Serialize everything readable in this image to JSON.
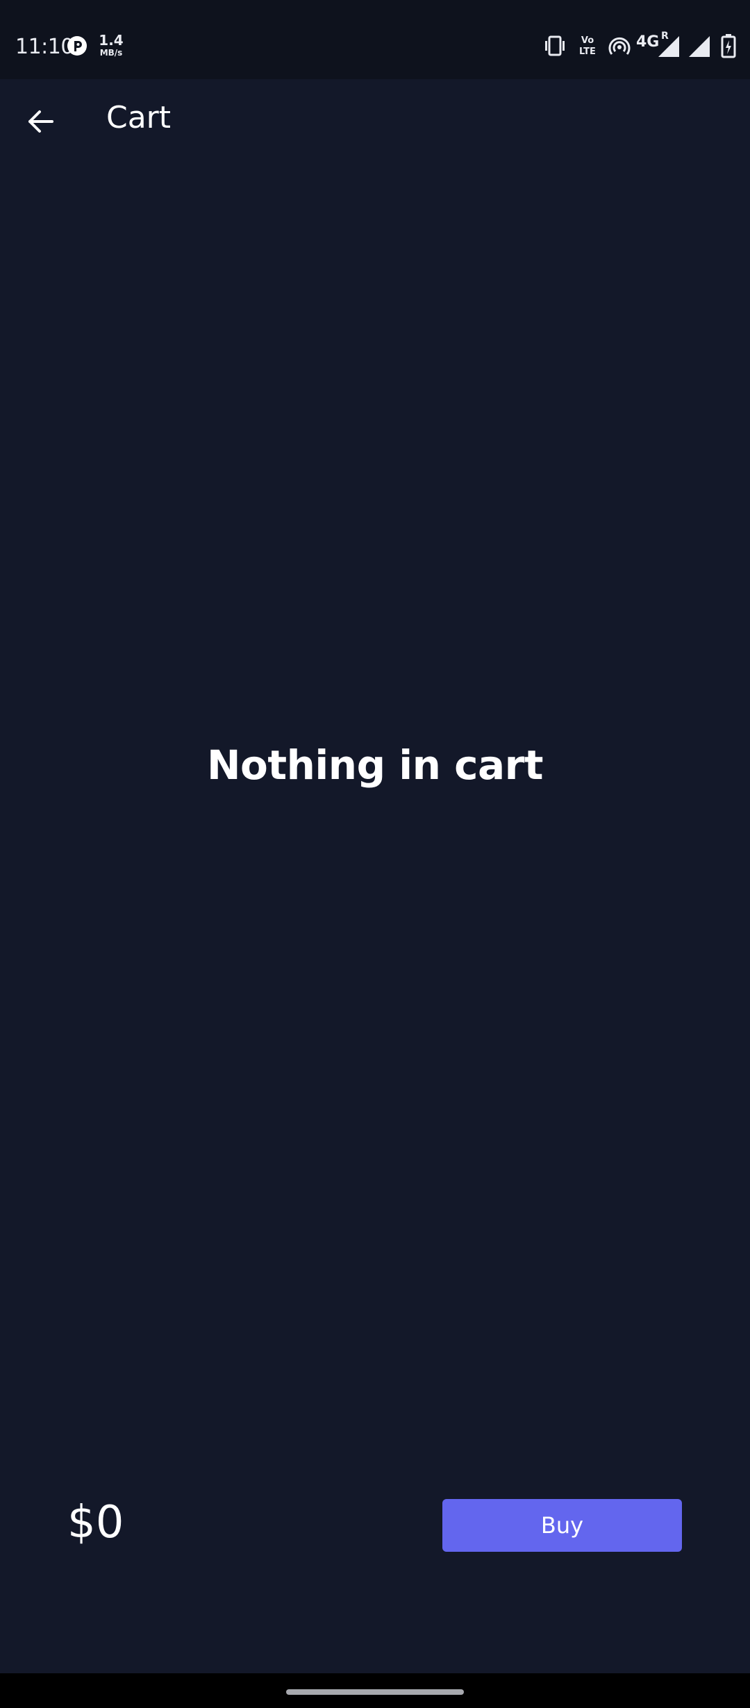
{
  "status_bar": {
    "time": "11:10",
    "net_speed_value": "1.4",
    "net_speed_unit": "MB/s",
    "volte_top": "Vo",
    "volte_bottom": "LTE",
    "network_type": "4G",
    "roaming": "R",
    "icons": [
      "app-notification-icon",
      "vibrate-icon",
      "volte-icon",
      "hotspot-icon",
      "signal-icon",
      "signal-icon",
      "battery-charging-icon"
    ]
  },
  "app_bar": {
    "title": "Cart",
    "back_icon": "arrow-left-icon"
  },
  "main": {
    "empty_message": "Nothing in cart"
  },
  "footer": {
    "total": "$0",
    "buy_label": "Buy"
  },
  "colors": {
    "background": "#131829",
    "status_bar": "#0e121d",
    "accent": "#6366ee",
    "text": "#ffffff"
  }
}
